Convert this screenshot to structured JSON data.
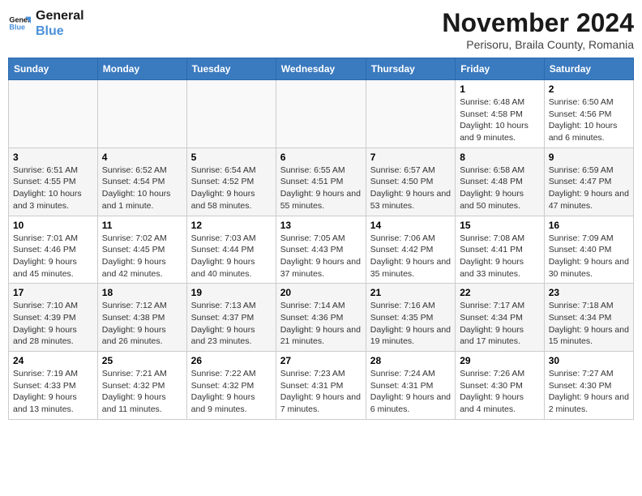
{
  "logo": {
    "line1": "General",
    "line2": "Blue"
  },
  "title": "November 2024",
  "location": "Perisoru, Braila County, Romania",
  "days_of_week": [
    "Sunday",
    "Monday",
    "Tuesday",
    "Wednesday",
    "Thursday",
    "Friday",
    "Saturday"
  ],
  "weeks": [
    [
      {
        "day": "",
        "info": "",
        "empty": true
      },
      {
        "day": "",
        "info": "",
        "empty": true
      },
      {
        "day": "",
        "info": "",
        "empty": true
      },
      {
        "day": "",
        "info": "",
        "empty": true
      },
      {
        "day": "",
        "info": "",
        "empty": true
      },
      {
        "day": "1",
        "info": "Sunrise: 6:48 AM\nSunset: 4:58 PM\nDaylight: 10 hours and 9 minutes."
      },
      {
        "day": "2",
        "info": "Sunrise: 6:50 AM\nSunset: 4:56 PM\nDaylight: 10 hours and 6 minutes."
      }
    ],
    [
      {
        "day": "3",
        "info": "Sunrise: 6:51 AM\nSunset: 4:55 PM\nDaylight: 10 hours and 3 minutes."
      },
      {
        "day": "4",
        "info": "Sunrise: 6:52 AM\nSunset: 4:54 PM\nDaylight: 10 hours and 1 minute."
      },
      {
        "day": "5",
        "info": "Sunrise: 6:54 AM\nSunset: 4:52 PM\nDaylight: 9 hours and 58 minutes."
      },
      {
        "day": "6",
        "info": "Sunrise: 6:55 AM\nSunset: 4:51 PM\nDaylight: 9 hours and 55 minutes."
      },
      {
        "day": "7",
        "info": "Sunrise: 6:57 AM\nSunset: 4:50 PM\nDaylight: 9 hours and 53 minutes."
      },
      {
        "day": "8",
        "info": "Sunrise: 6:58 AM\nSunset: 4:48 PM\nDaylight: 9 hours and 50 minutes."
      },
      {
        "day": "9",
        "info": "Sunrise: 6:59 AM\nSunset: 4:47 PM\nDaylight: 9 hours and 47 minutes."
      }
    ],
    [
      {
        "day": "10",
        "info": "Sunrise: 7:01 AM\nSunset: 4:46 PM\nDaylight: 9 hours and 45 minutes."
      },
      {
        "day": "11",
        "info": "Sunrise: 7:02 AM\nSunset: 4:45 PM\nDaylight: 9 hours and 42 minutes."
      },
      {
        "day": "12",
        "info": "Sunrise: 7:03 AM\nSunset: 4:44 PM\nDaylight: 9 hours and 40 minutes."
      },
      {
        "day": "13",
        "info": "Sunrise: 7:05 AM\nSunset: 4:43 PM\nDaylight: 9 hours and 37 minutes."
      },
      {
        "day": "14",
        "info": "Sunrise: 7:06 AM\nSunset: 4:42 PM\nDaylight: 9 hours and 35 minutes."
      },
      {
        "day": "15",
        "info": "Sunrise: 7:08 AM\nSunset: 4:41 PM\nDaylight: 9 hours and 33 minutes."
      },
      {
        "day": "16",
        "info": "Sunrise: 7:09 AM\nSunset: 4:40 PM\nDaylight: 9 hours and 30 minutes."
      }
    ],
    [
      {
        "day": "17",
        "info": "Sunrise: 7:10 AM\nSunset: 4:39 PM\nDaylight: 9 hours and 28 minutes."
      },
      {
        "day": "18",
        "info": "Sunrise: 7:12 AM\nSunset: 4:38 PM\nDaylight: 9 hours and 26 minutes."
      },
      {
        "day": "19",
        "info": "Sunrise: 7:13 AM\nSunset: 4:37 PM\nDaylight: 9 hours and 23 minutes."
      },
      {
        "day": "20",
        "info": "Sunrise: 7:14 AM\nSunset: 4:36 PM\nDaylight: 9 hours and 21 minutes."
      },
      {
        "day": "21",
        "info": "Sunrise: 7:16 AM\nSunset: 4:35 PM\nDaylight: 9 hours and 19 minutes."
      },
      {
        "day": "22",
        "info": "Sunrise: 7:17 AM\nSunset: 4:34 PM\nDaylight: 9 hours and 17 minutes."
      },
      {
        "day": "23",
        "info": "Sunrise: 7:18 AM\nSunset: 4:34 PM\nDaylight: 9 hours and 15 minutes."
      }
    ],
    [
      {
        "day": "24",
        "info": "Sunrise: 7:19 AM\nSunset: 4:33 PM\nDaylight: 9 hours and 13 minutes."
      },
      {
        "day": "25",
        "info": "Sunrise: 7:21 AM\nSunset: 4:32 PM\nDaylight: 9 hours and 11 minutes."
      },
      {
        "day": "26",
        "info": "Sunrise: 7:22 AM\nSunset: 4:32 PM\nDaylight: 9 hours and 9 minutes."
      },
      {
        "day": "27",
        "info": "Sunrise: 7:23 AM\nSunset: 4:31 PM\nDaylight: 9 hours and 7 minutes."
      },
      {
        "day": "28",
        "info": "Sunrise: 7:24 AM\nSunset: 4:31 PM\nDaylight: 9 hours and 6 minutes."
      },
      {
        "day": "29",
        "info": "Sunrise: 7:26 AM\nSunset: 4:30 PM\nDaylight: 9 hours and 4 minutes."
      },
      {
        "day": "30",
        "info": "Sunrise: 7:27 AM\nSunset: 4:30 PM\nDaylight: 9 hours and 2 minutes."
      }
    ]
  ]
}
